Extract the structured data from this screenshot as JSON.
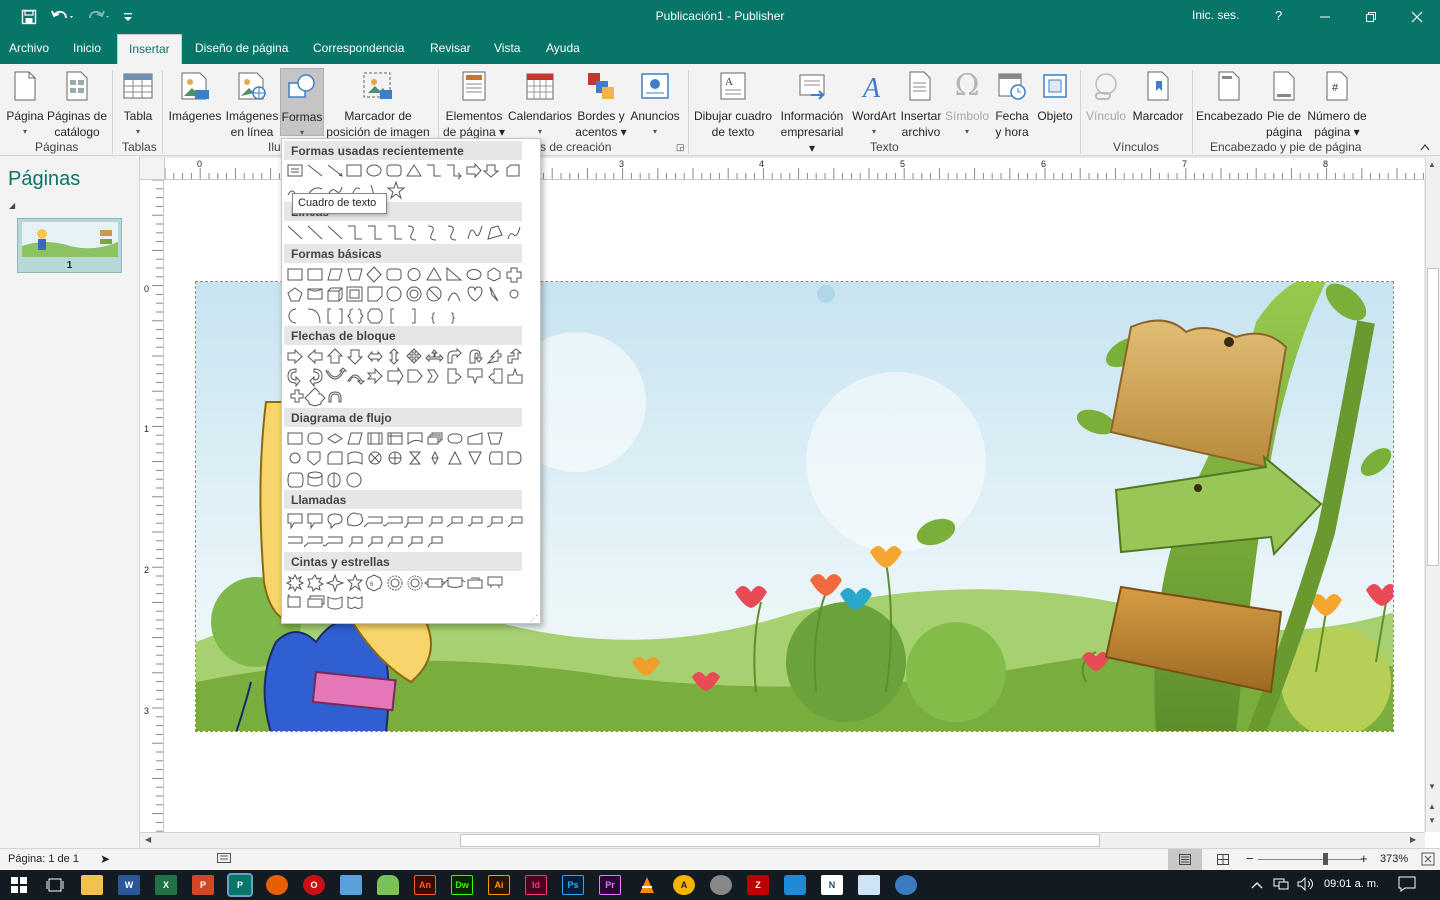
{
  "window": {
    "title": "Publicación1  -  Publisher",
    "sign_in": "Inic. ses.",
    "help": "?"
  },
  "tabs": [
    "Archivo",
    "Inicio",
    "Insertar",
    "Diseño de página",
    "Correspondencia",
    "Revisar",
    "Vista",
    "Ayuda"
  ],
  "active_tab": "Insertar",
  "ribbon": {
    "pagina": {
      "l1": "Página",
      "l2": "▾"
    },
    "paginas_catalogo": {
      "l1": "Páginas de",
      "l2": "catálogo"
    },
    "tabla": {
      "l1": "Tabla",
      "l2": "▾"
    },
    "imagenes": {
      "l1": "Imágenes"
    },
    "imagenes_linea": {
      "l1": "Imágenes",
      "l2": "en línea"
    },
    "formas": {
      "l1": "Formas",
      "l2": "▾"
    },
    "marcador_imagen": {
      "l1": "Marcador de",
      "l2": "posición de imagen"
    },
    "elementos_pagina": {
      "l1": "Elementos",
      "l2": "de página ▾"
    },
    "calendarios": {
      "l1": "Calendarios",
      "l2": "▾"
    },
    "bordes_acentos": {
      "l1": "Bordes y",
      "l2": "acentos ▾"
    },
    "anuncios": {
      "l1": "Anuncios",
      "l2": "▾"
    },
    "dibujar_cuadro": {
      "l1": "Dibujar cuadro",
      "l2": "de texto"
    },
    "info_empresarial": {
      "l1": "Información",
      "l2": "empresarial ▾"
    },
    "wordart": {
      "l1": "WordArt",
      "l2": "▾"
    },
    "insertar_archivo": {
      "l1": "Insertar",
      "l2": "archivo"
    },
    "simbolo": {
      "l1": "Símbolo",
      "l2": "▾"
    },
    "fecha_hora": {
      "l1": "Fecha",
      "l2": "y hora"
    },
    "objeto": {
      "l1": "Objeto"
    },
    "vinculo": {
      "l1": "Vínculo"
    },
    "marcador": {
      "l1": "Marcador"
    },
    "encabezado": {
      "l1": "Encabezado"
    },
    "pie_pagina": {
      "l1": "Pie de",
      "l2": "página"
    },
    "numero_pagina": {
      "l1": "Número de",
      "l2": "página ▾"
    },
    "groups": {
      "paginas": "Páginas",
      "tablas": "Tablas",
      "ilustraciones": "Ilu",
      "creacion": "s de creación",
      "texto": "Texto",
      "vinculos": "Vínculos",
      "encabezado_pie": "Encabezado y pie de página"
    }
  },
  "pages_pane": {
    "title": "Páginas",
    "thumb_number": "1"
  },
  "ruler": {
    "top": [
      "0",
      "3",
      "4",
      "5",
      "6",
      "7",
      "8"
    ],
    "left": [
      "0",
      "1",
      "2",
      "3"
    ]
  },
  "shapes_menu": {
    "sections": [
      "Formas usadas recientemente",
      "Líneas",
      "Formas básicas",
      "Flechas de bloque",
      "Diagrama de flujo",
      "Llamadas",
      "Cintas y estrellas"
    ],
    "tooltip": "Cuadro de texto"
  },
  "status": {
    "page": "Página: 1 de 1",
    "zoom": "373%"
  },
  "clock": {
    "time": "09:01 a. m."
  },
  "taskbar_apps": [
    "An",
    "Dw",
    "Ai",
    "Id",
    "Ps",
    "Pr"
  ],
  "colors": {
    "accent": "#077568",
    "ribbon_bg": "#f3f3f3",
    "taskbar": "#121a22"
  }
}
